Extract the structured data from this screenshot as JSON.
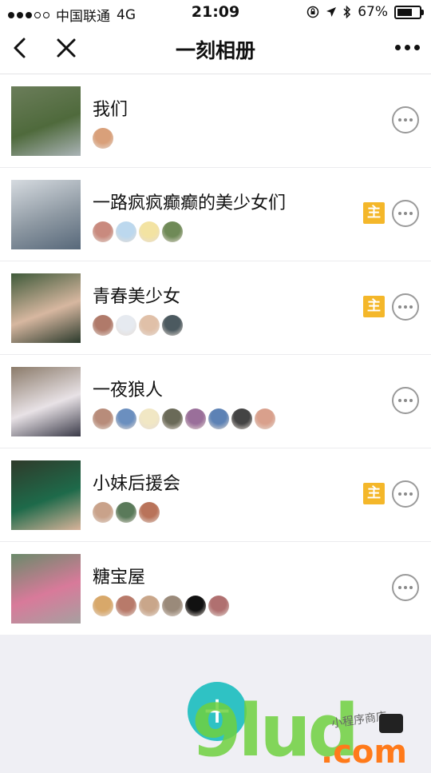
{
  "status_bar": {
    "carrier": "中国联通",
    "network": "4G",
    "time": "21:09",
    "battery": "67%",
    "signal_bars_filled": 3,
    "signal_bars_total": 5
  },
  "nav": {
    "title": "一刻相册",
    "back_icon": "chevron-left-icon",
    "close_icon": "close-icon",
    "more_icon": "more-horizontal-icon"
  },
  "albums": [
    {
      "name": "我们",
      "is_owner": false,
      "members": [
        "#d9a07a"
      ],
      "thumb": [
        "#6b7d5a",
        "#4f6a3c",
        "#aab3b6"
      ]
    },
    {
      "name": "一路疯疯癫癫的美少女们",
      "is_owner": true,
      "members": [
        "#c98a7e",
        "#bcd8ee",
        "#f3e3a2",
        "#6f8a57"
      ],
      "thumb": [
        "#d6dbe0",
        "#8d98a2",
        "#57687a"
      ]
    },
    {
      "name": "青春美少女",
      "is_owner": true,
      "members": [
        "#b07a6a",
        "#e6eaf0",
        "#e0c0a8",
        "#4c5a60"
      ],
      "thumb": [
        "#3f5a3a",
        "#d7b7a0",
        "#2b3a2c"
      ]
    },
    {
      "name": "一夜狼人",
      "is_owner": false,
      "members": [
        "#b88c7a",
        "#6b8fbf",
        "#f1e7c4",
        "#6a6a58",
        "#9a6f9a",
        "#5d82b5",
        "#444444",
        "#d9a08c"
      ],
      "thumb": [
        "#8b7b6a",
        "#e8e2e6",
        "#3a3a48"
      ]
    },
    {
      "name": "小妹后援会",
      "is_owner": true,
      "members": [
        "#c9a28a",
        "#5a7a5a",
        "#b9735a"
      ],
      "thumb": [
        "#2f3a2a",
        "#1e6a4a",
        "#d9b39a"
      ]
    },
    {
      "name": "糖宝屋",
      "is_owner": false,
      "members": [
        "#d8a86a",
        "#b87a6a",
        "#c9a68a",
        "#9a8a7a",
        "#111111",
        "#b07070"
      ],
      "thumb": [
        "#6a8a6a",
        "#d87a9a",
        "#a6a0a0"
      ]
    }
  ],
  "owner_badge": "主",
  "fab_label": "+",
  "watermark": {
    "logo": "9lud",
    "domain": ".com",
    "tagline": "小程序商店"
  }
}
